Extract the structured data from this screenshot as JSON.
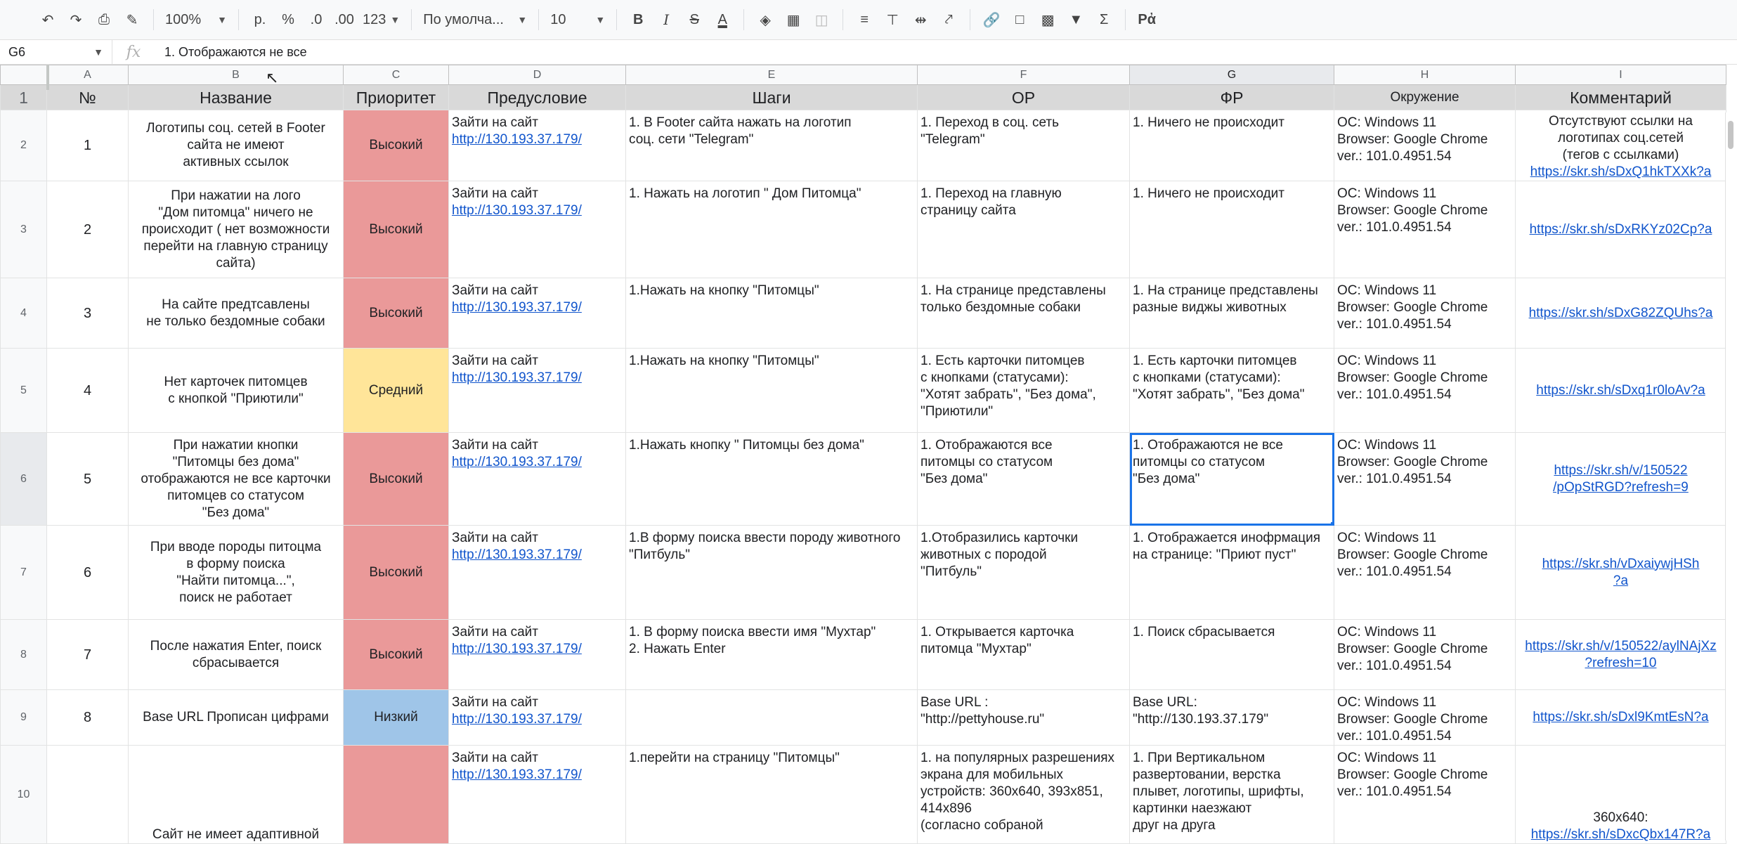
{
  "toolbar": {
    "zoom": "100%",
    "currency": "р.",
    "percent": "%",
    "dec_less": ".0",
    "dec_more": ".00",
    "format_more": "123",
    "font": "По умолча...",
    "font_size": "10",
    "bold": "B",
    "italic": "I",
    "text_color": "A"
  },
  "formula_bar": {
    "cell_ref": "G6",
    "fx": "fx",
    "content": "1. Отображаются не все"
  },
  "columns": [
    "A",
    "B",
    "C",
    "D",
    "E",
    "F",
    "G",
    "H",
    "I"
  ],
  "header_row": {
    "num": "1",
    "cells": [
      "№",
      "Название",
      "Приоритет",
      "Предусловие",
      "Шаги",
      "ОР",
      "ФР",
      "Окружение",
      "Комментарий"
    ]
  },
  "env": [
    "ОС: Windows 11",
    "Browser: Google Chrome",
    "ver.: 101.0.4951.54"
  ],
  "pre_text": "Зайти на сайт",
  "pre_link": "http://130.193.37.179/",
  "rows": [
    {
      "rn": "2",
      "id": "1",
      "name": [
        "Логотипы соц. сетей в Footer",
        "сайта не имеют",
        "активных ссылок"
      ],
      "priority": "Высокий",
      "steps": [
        "1. В Footer сайта нажать на логотип",
        "соц. сети \"Telegram\""
      ],
      "or": [
        "1. Переход в соц. сеть",
        "\"Telegram\""
      ],
      "fr": [
        "1. Ничего не происходит"
      ],
      "comment": [
        "Отсутствуют ссылки на",
        "логотипах соц.сетей",
        "(тегов с ссылками)"
      ],
      "link": [
        "https://skr.sh/sDxQ1hkTXXk?a"
      ]
    },
    {
      "rn": "3",
      "id": "2",
      "name": [
        "При нажатии на лого",
        "\"Дом питомца\" ничего не",
        "происходит ( нет возможности",
        "перейти на главную страницу",
        "сайта)"
      ],
      "priority": "Высокий",
      "steps": [
        "1. Нажать на логотип \" Дом Питомца\""
      ],
      "or": [
        "1. Переход на главную",
        "страницу сайта"
      ],
      "fr": [
        "1. Ничего не происходит"
      ],
      "comment": [],
      "link": [
        "https://skr.sh/sDxRKYz02Cp?a"
      ]
    },
    {
      "rn": "4",
      "id": "3",
      "name": [
        "На сайте предтсавлены",
        "не только бездомные собаки"
      ],
      "priority": "Высокий",
      "steps": [
        "1.Нажать на кнопку \"Питомцы\""
      ],
      "or": [
        "1. На странице представлены",
        "только бездомные собаки"
      ],
      "fr": [
        "1. На странице представлены",
        "разные виджы животных"
      ],
      "comment": [],
      "link": [
        "https://skr.sh/sDxG82ZQUhs?a"
      ]
    },
    {
      "rn": "5",
      "id": "4",
      "name": [
        "Нет карточек питомцев",
        "с кнопкой \"Приютили\""
      ],
      "priority": "Средний",
      "steps": [
        "1.Нажать на кнопку \"Питомцы\""
      ],
      "or": [
        "1. Есть карточки питомцев",
        "с кнопками (статусами):",
        "\"Хотят забрать\", \"Без дома\",",
        "\"Приютили\""
      ],
      "fr": [
        "1. Есть карточки питомцев",
        "с кнопками (статусами):",
        "\"Хотят забрать\", \"Без дома\""
      ],
      "comment": [],
      "link": [
        "https://skr.sh/sDxq1r0loAv?a"
      ]
    },
    {
      "rn": "6",
      "id": "5",
      "name": [
        "При нажатии кнопки",
        "\"Питомцы без дома\"",
        "отображаются не все карточки",
        "питомцев со статусом",
        "\"Без дома\""
      ],
      "priority": "Высокий",
      "steps": [
        "1.Нажать кнопку \" Питомцы без дома\""
      ],
      "or": [
        "1. Отображаются все",
        "питомцы со статусом",
        "\"Без дома\""
      ],
      "fr": [
        "1. Отображаются не все",
        "питомцы со статусом",
        "\"Без дома\""
      ],
      "comment": [],
      "link": [
        "https://skr.sh/v/150522",
        "/pOpStRGD?refresh=9"
      ]
    },
    {
      "rn": "7",
      "id": "6",
      "name": [
        "При вводе породы питоцма",
        "в форму поиска",
        "\"Найти питомца...\",",
        "поиск не работает"
      ],
      "priority": "Высокий",
      "steps": [
        "1.В форму поиска ввести породу животного",
        "\"Питбуль\""
      ],
      "or": [
        "1.Отобразились карточки",
        "животных с породой",
        "\"Питбуль\""
      ],
      "fr": [
        "1. Отображается инофрмация",
        "на странице: \"Приют пуст\""
      ],
      "comment": [],
      "link": [
        "https://skr.sh/vDxaiywjHSh",
        "?a"
      ]
    },
    {
      "rn": "8",
      "id": "7",
      "name": [
        "После нажатия Enter, поиск",
        "сбрасывается"
      ],
      "priority": "Высокий",
      "steps": [
        "1. В форму поиска ввести имя \"Мухтар\"",
        "2. Нажать Enter"
      ],
      "or": [
        "1. Открывается карточка",
        "питомца \"Мухтар\""
      ],
      "fr": [
        "1. Поиск сбрасывается"
      ],
      "comment": [],
      "link": [
        "https://skr.sh/v/150522/aylNAjXz",
        "?refresh=10"
      ]
    },
    {
      "rn": "9",
      "id": "8",
      "name": [
        "Base URL Прописан цифрами"
      ],
      "priority": "Низкий",
      "steps": [],
      "or": [
        "Base URL :",
        "\"http://pettyhouse.ru\""
      ],
      "fr": [
        "Base URL:",
        "\"http://130.193.37.179\""
      ],
      "comment": [],
      "link": [
        "https://skr.sh/sDxl9KmtEsN?a"
      ]
    },
    {
      "rn": "10",
      "id": "",
      "name": [
        "Сайт не имеет адаптивной"
      ],
      "priority": "",
      "steps": [
        "1.перейти на страницу \"Питомцы\""
      ],
      "or": [
        "1. на популярных разрешениях",
        "экрана для мобильных",
        "устройств: 360x640, 393x851,",
        "414x896",
        "(согласно собраной"
      ],
      "fr": [
        "1. При Вертикальном",
        "развертовании, верстка",
        "плывет, логотипы, шрифты,",
        "картинки наезжают",
        "друг на друга"
      ],
      "comment": [
        "360x640:"
      ],
      "link": [
        "https://skr.sh/sDxcQbx147R?a"
      ]
    }
  ]
}
